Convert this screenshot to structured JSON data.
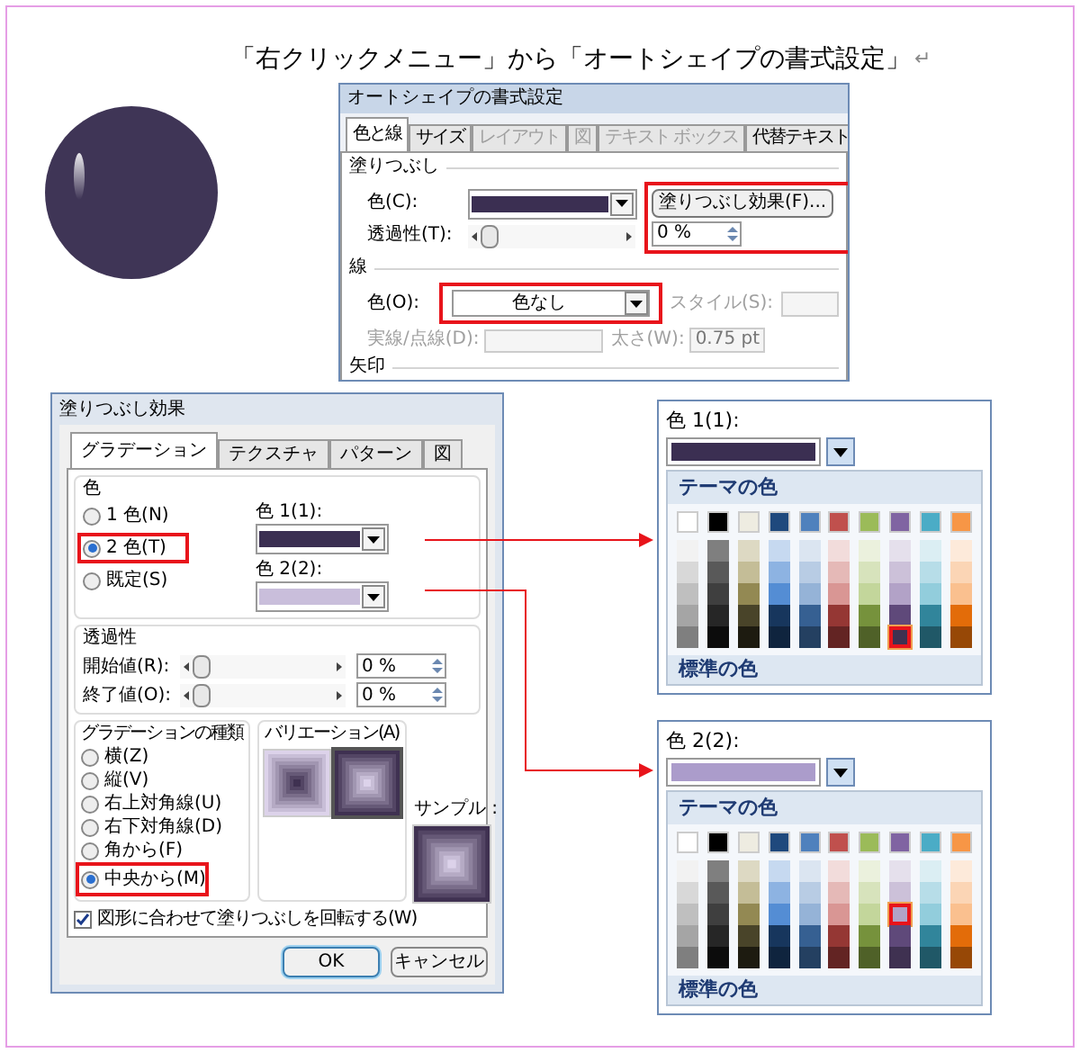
{
  "caption": {
    "text": "「右クリックメニュー」から「オートシェイプの書式設定」",
    "mark": "↵"
  },
  "format_dialog": {
    "title": "オートシェイプの書式設定",
    "tabs": [
      {
        "label": "色と線",
        "selected": true,
        "disabled": false
      },
      {
        "label": "サイズ",
        "selected": false,
        "disabled": false
      },
      {
        "label": "レイアウト",
        "selected": false,
        "disabled": true
      },
      {
        "label": "図",
        "selected": false,
        "disabled": true
      },
      {
        "label": "テキスト ボックス",
        "selected": false,
        "disabled": true
      },
      {
        "label": "代替テキスト",
        "selected": false,
        "disabled": false
      }
    ],
    "fill": {
      "heading": "塗りつぶし",
      "color_label": "色(C):",
      "color": "#3b2f52",
      "effects_button": "塗りつぶし効果(F)...",
      "transparency_label": "透過性(T):",
      "transparency_slider": {
        "level": 0
      },
      "transparency_value": "0 %"
    },
    "line": {
      "heading": "線",
      "color_label": "色(O):",
      "color_value": "色なし",
      "style_label": "スタイル(S):",
      "dash_label": "実線/点線(D):",
      "weight_label": "太さ(W):",
      "weight_value": "0.75 pt"
    },
    "arrows_heading": "矢印"
  },
  "effects_dialog": {
    "title": "塗りつぶし効果",
    "tabs": [
      {
        "label": "グラデーション",
        "selected": true
      },
      {
        "label": "テクスチャ",
        "selected": false
      },
      {
        "label": "パターン",
        "selected": false
      },
      {
        "label": "図",
        "selected": false
      }
    ],
    "color_group": {
      "heading": "色",
      "options": [
        {
          "label": "1 色(N)",
          "selected": false
        },
        {
          "label": "2 色(T)",
          "selected": true
        },
        {
          "label": "既定(S)",
          "selected": false
        }
      ],
      "swatches": [
        {
          "label": "色 1(1):",
          "color": "#3b2f52"
        },
        {
          "label": "色 2(2):",
          "color": "#c9bedb"
        }
      ]
    },
    "transparency": {
      "heading": "透過性",
      "rows": [
        {
          "label": "開始値(R):",
          "level": 0,
          "value": "0 %"
        },
        {
          "label": "終了値(O):",
          "level": 0,
          "value": "0 %"
        }
      ]
    },
    "gradient_types": {
      "heading": "グラデーションの種類",
      "options": [
        {
          "label": "横(Z)",
          "selected": false
        },
        {
          "label": "縦(V)",
          "selected": false
        },
        {
          "label": "右上対角線(U)",
          "selected": false
        },
        {
          "label": "右下対角線(D)",
          "selected": false
        },
        {
          "label": "角から(F)",
          "selected": false
        },
        {
          "label": "中央から(M)",
          "selected": true
        }
      ]
    },
    "variations": {
      "heading": "バリエーション(A)",
      "items": [
        {
          "kind": "dark-center",
          "selected": false
        },
        {
          "kind": "light-center",
          "selected": true
        }
      ]
    },
    "sample_label": "サンプル :",
    "rotate": {
      "label": "図形に合わせて塗りつぶしを回転する(W)",
      "checked": true
    },
    "buttons": [
      {
        "label": "OK",
        "default": true
      },
      {
        "label": "キャンセル",
        "default": false
      }
    ]
  },
  "pickers": [
    {
      "label": "色 1(1):",
      "color": "#3b2f52",
      "theme_heading": "テーマの色",
      "standard_heading": "標準の色",
      "columns": [
        {
          "color": "#ffffff",
          "shades": [
            {
              "color": "#f2f2f2",
              "selected": false
            },
            {
              "color": "#d8d8d8",
              "selected": false
            },
            {
              "color": "#bfbfbf",
              "selected": false
            },
            {
              "color": "#a5a5a5",
              "selected": false
            },
            {
              "color": "#7f7f7f",
              "selected": false
            }
          ]
        },
        {
          "color": "#000000",
          "shades": [
            {
              "color": "#7f7f7f",
              "selected": false
            },
            {
              "color": "#595959",
              "selected": false
            },
            {
              "color": "#3f3f3f",
              "selected": false
            },
            {
              "color": "#262626",
              "selected": false
            },
            {
              "color": "#0c0c0c",
              "selected": false
            }
          ]
        },
        {
          "color": "#eeece1",
          "shades": [
            {
              "color": "#ddd9c3",
              "selected": false
            },
            {
              "color": "#c4bd97",
              "selected": false
            },
            {
              "color": "#938953",
              "selected": false
            },
            {
              "color": "#494429",
              "selected": false
            },
            {
              "color": "#1d1b10",
              "selected": false
            }
          ]
        },
        {
          "color": "#1f497d",
          "shades": [
            {
              "color": "#c6d9f0",
              "selected": false
            },
            {
              "color": "#8db3e2",
              "selected": false
            },
            {
              "color": "#548dd4",
              "selected": false
            },
            {
              "color": "#17365d",
              "selected": false
            },
            {
              "color": "#0f243e",
              "selected": false
            }
          ]
        },
        {
          "color": "#4f81bd",
          "shades": [
            {
              "color": "#dbe5f1",
              "selected": false
            },
            {
              "color": "#b8cce4",
              "selected": false
            },
            {
              "color": "#95b3d7",
              "selected": false
            },
            {
              "color": "#366092",
              "selected": false
            },
            {
              "color": "#244061",
              "selected": false
            }
          ]
        },
        {
          "color": "#c0504d",
          "shades": [
            {
              "color": "#f2dcdb",
              "selected": false
            },
            {
              "color": "#e5b9b7",
              "selected": false
            },
            {
              "color": "#d99694",
              "selected": false
            },
            {
              "color": "#953734",
              "selected": false
            },
            {
              "color": "#632423",
              "selected": false
            }
          ]
        },
        {
          "color": "#9bbb59",
          "shades": [
            {
              "color": "#ebf1dd",
              "selected": false
            },
            {
              "color": "#d7e3bc",
              "selected": false
            },
            {
              "color": "#c3d69b",
              "selected": false
            },
            {
              "color": "#76923c",
              "selected": false
            },
            {
              "color": "#4f6128",
              "selected": false
            }
          ]
        },
        {
          "color": "#8064a2",
          "shades": [
            {
              "color": "#e5e0ec",
              "selected": false
            },
            {
              "color": "#ccc1d9",
              "selected": false
            },
            {
              "color": "#b2a2c7",
              "selected": false
            },
            {
              "color": "#5f497a",
              "selected": false
            },
            {
              "color": "#3f3151",
              "selected": true
            }
          ]
        },
        {
          "color": "#4bacc6",
          "shades": [
            {
              "color": "#dbeef3",
              "selected": false
            },
            {
              "color": "#b7dde8",
              "selected": false
            },
            {
              "color": "#92cddc",
              "selected": false
            },
            {
              "color": "#31859b",
              "selected": false
            },
            {
              "color": "#205867",
              "selected": false
            }
          ]
        },
        {
          "color": "#f79646",
          "shades": [
            {
              "color": "#fdeada",
              "selected": false
            },
            {
              "color": "#fbd5b5",
              "selected": false
            },
            {
              "color": "#fac08f",
              "selected": false
            },
            {
              "color": "#e36c09",
              "selected": false
            },
            {
              "color": "#974806",
              "selected": false
            }
          ]
        }
      ]
    },
    {
      "label": "色 2(2):",
      "color": "#ab9ccb",
      "theme_heading": "テーマの色",
      "standard_heading": "標準の色",
      "columns": [
        {
          "color": "#ffffff",
          "shades": [
            {
              "color": "#f2f2f2",
              "selected": false
            },
            {
              "color": "#d8d8d8",
              "selected": false
            },
            {
              "color": "#bfbfbf",
              "selected": false
            },
            {
              "color": "#a5a5a5",
              "selected": false
            },
            {
              "color": "#7f7f7f",
              "selected": false
            }
          ]
        },
        {
          "color": "#000000",
          "shades": [
            {
              "color": "#7f7f7f",
              "selected": false
            },
            {
              "color": "#595959",
              "selected": false
            },
            {
              "color": "#3f3f3f",
              "selected": false
            },
            {
              "color": "#262626",
              "selected": false
            },
            {
              "color": "#0c0c0c",
              "selected": false
            }
          ]
        },
        {
          "color": "#eeece1",
          "shades": [
            {
              "color": "#ddd9c3",
              "selected": false
            },
            {
              "color": "#c4bd97",
              "selected": false
            },
            {
              "color": "#938953",
              "selected": false
            },
            {
              "color": "#494429",
              "selected": false
            },
            {
              "color": "#1d1b10",
              "selected": false
            }
          ]
        },
        {
          "color": "#1f497d",
          "shades": [
            {
              "color": "#c6d9f0",
              "selected": false
            },
            {
              "color": "#8db3e2",
              "selected": false
            },
            {
              "color": "#548dd4",
              "selected": false
            },
            {
              "color": "#17365d",
              "selected": false
            },
            {
              "color": "#0f243e",
              "selected": false
            }
          ]
        },
        {
          "color": "#4f81bd",
          "shades": [
            {
              "color": "#dbe5f1",
              "selected": false
            },
            {
              "color": "#b8cce4",
              "selected": false
            },
            {
              "color": "#95b3d7",
              "selected": false
            },
            {
              "color": "#366092",
              "selected": false
            },
            {
              "color": "#244061",
              "selected": false
            }
          ]
        },
        {
          "color": "#c0504d",
          "shades": [
            {
              "color": "#f2dcdb",
              "selected": false
            },
            {
              "color": "#e5b9b7",
              "selected": false
            },
            {
              "color": "#d99694",
              "selected": false
            },
            {
              "color": "#953734",
              "selected": false
            },
            {
              "color": "#632423",
              "selected": false
            }
          ]
        },
        {
          "color": "#9bbb59",
          "shades": [
            {
              "color": "#ebf1dd",
              "selected": false
            },
            {
              "color": "#d7e3bc",
              "selected": false
            },
            {
              "color": "#c3d69b",
              "selected": false
            },
            {
              "color": "#76923c",
              "selected": false
            },
            {
              "color": "#4f6128",
              "selected": false
            }
          ]
        },
        {
          "color": "#8064a2",
          "shades": [
            {
              "color": "#e5e0ec",
              "selected": false
            },
            {
              "color": "#ccc1d9",
              "selected": false
            },
            {
              "color": "#b2a2c7",
              "selected": true
            },
            {
              "color": "#5f497a",
              "selected": false
            },
            {
              "color": "#3f3151",
              "selected": false
            }
          ]
        },
        {
          "color": "#4bacc6",
          "shades": [
            {
              "color": "#dbeef3",
              "selected": false
            },
            {
              "color": "#b7dde8",
              "selected": false
            },
            {
              "color": "#92cddc",
              "selected": false
            },
            {
              "color": "#31859b",
              "selected": false
            },
            {
              "color": "#205867",
              "selected": false
            }
          ]
        },
        {
          "color": "#f79646",
          "shades": [
            {
              "color": "#fdeada",
              "selected": false
            },
            {
              "color": "#fbd5b5",
              "selected": false
            },
            {
              "color": "#fac08f",
              "selected": false
            },
            {
              "color": "#e36c09",
              "selected": false
            },
            {
              "color": "#974806",
              "selected": false
            }
          ]
        }
      ]
    }
  ]
}
